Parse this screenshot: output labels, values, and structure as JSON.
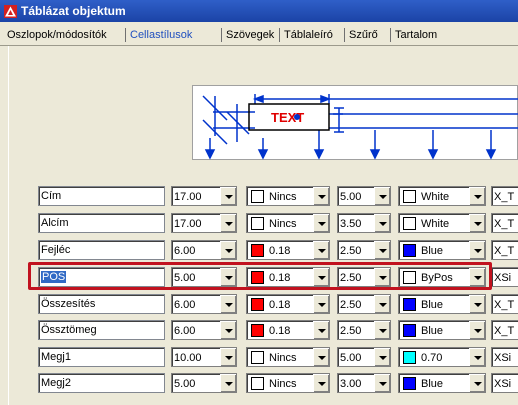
{
  "window": {
    "title": "Táblázat objektum"
  },
  "tabs": [
    "Oszlopok/módosítók",
    "Cellastílusok",
    "Szövegek",
    "Táblaleíró",
    "Szűrő",
    "Tartalom"
  ],
  "active_tab": "Cellastílusok",
  "preview": {
    "text": "TEXT"
  },
  "rows": [
    {
      "name": "Cím",
      "height": "17.00",
      "color": "#ffffff",
      "fill": "Nincs",
      "size": "5.00",
      "text_color_swatch": "#ffffff",
      "text_color": "White",
      "font": "X_T"
    },
    {
      "name": "Alcím",
      "height": "17.00",
      "color": "#ffffff",
      "fill": "Nincs",
      "size": "3.50",
      "text_color_swatch": "#ffffff",
      "text_color": "White",
      "font": "X_T"
    },
    {
      "name": "Fejléc",
      "height": "6.00",
      "color": "#ff0000",
      "fill": "0.18",
      "size": "2.50",
      "text_color_swatch": "#0000ff",
      "text_color": "Blue",
      "font": "X_T"
    },
    {
      "name": "POS",
      "height": "5.00",
      "color": "#ff0000",
      "fill": "0.18",
      "size": "2.50",
      "text_color_swatch": "#ffffff",
      "text_color": "ByPos",
      "font": "XSi"
    },
    {
      "name": "Összesítés",
      "height": "6.00",
      "color": "#ff0000",
      "fill": "0.18",
      "size": "2.50",
      "text_color_swatch": "#0000ff",
      "text_color": "Blue",
      "font": "X_T"
    },
    {
      "name": "Össztömeg",
      "height": "6.00",
      "color": "#ff0000",
      "fill": "0.18",
      "size": "2.50",
      "text_color_swatch": "#0000ff",
      "text_color": "Blue",
      "font": "X_T"
    },
    {
      "name": "Megj1",
      "height": "10.00",
      "color": "#ffffff",
      "fill": "Nincs",
      "size": "5.00",
      "text_color_swatch": "#00ffff",
      "text_color": "0.70",
      "font": "XSi"
    },
    {
      "name": "Megj2",
      "height": "5.00",
      "color": "#ffffff",
      "fill": "Nincs",
      "size": "3.00",
      "text_color_swatch": "#0000ff",
      "text_color": "Blue",
      "font": "XSi"
    }
  ],
  "colors": {
    "titlebar": "#1b43a6",
    "highlight": "#c1121f",
    "selection": "#316ac5",
    "preview_lines": "#0033cc",
    "preview_text": "#e00000"
  }
}
